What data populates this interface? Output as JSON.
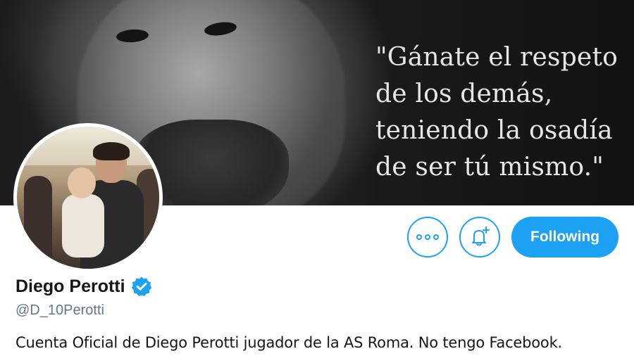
{
  "banner": {
    "quote": "\"Gánate el respeto\nde los demás,\nteniendo la osadía\nde ser tú mismo.\""
  },
  "profile": {
    "display_name": "Diego Perotti",
    "handle": "@D_10Perotti",
    "bio": "Cuenta Oficial de Diego Perotti jugador de la AS Roma. No tengo Facebook.",
    "verified_icon": "verified-badge-icon"
  },
  "actions": {
    "more_icon": "more-dots-icon",
    "notify_icon": "bell-plus-icon",
    "follow_label": "Following"
  },
  "colors": {
    "accent": "#1da1f2",
    "text_primary": "#14171a",
    "text_secondary": "#657786"
  }
}
